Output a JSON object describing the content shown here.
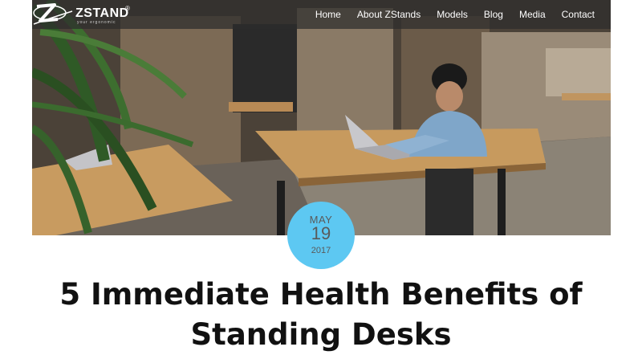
{
  "brand": {
    "name": "ZSTAND",
    "registered_mark": "®",
    "tagline": "your ergonomic"
  },
  "nav": {
    "items": [
      "Home",
      "About ZStands",
      "Models",
      "Blog",
      "Media",
      "Contact"
    ]
  },
  "post": {
    "date": {
      "month": "MAY",
      "day": "19",
      "year": "2017"
    },
    "title": "5 Immediate Health Benefits of Standing Desks"
  },
  "hero": {
    "image_description_icon": "office-photo-icon"
  },
  "colors": {
    "accent": "#5dc8f2",
    "navbar": "#2d2d2d",
    "title": "#111111"
  }
}
